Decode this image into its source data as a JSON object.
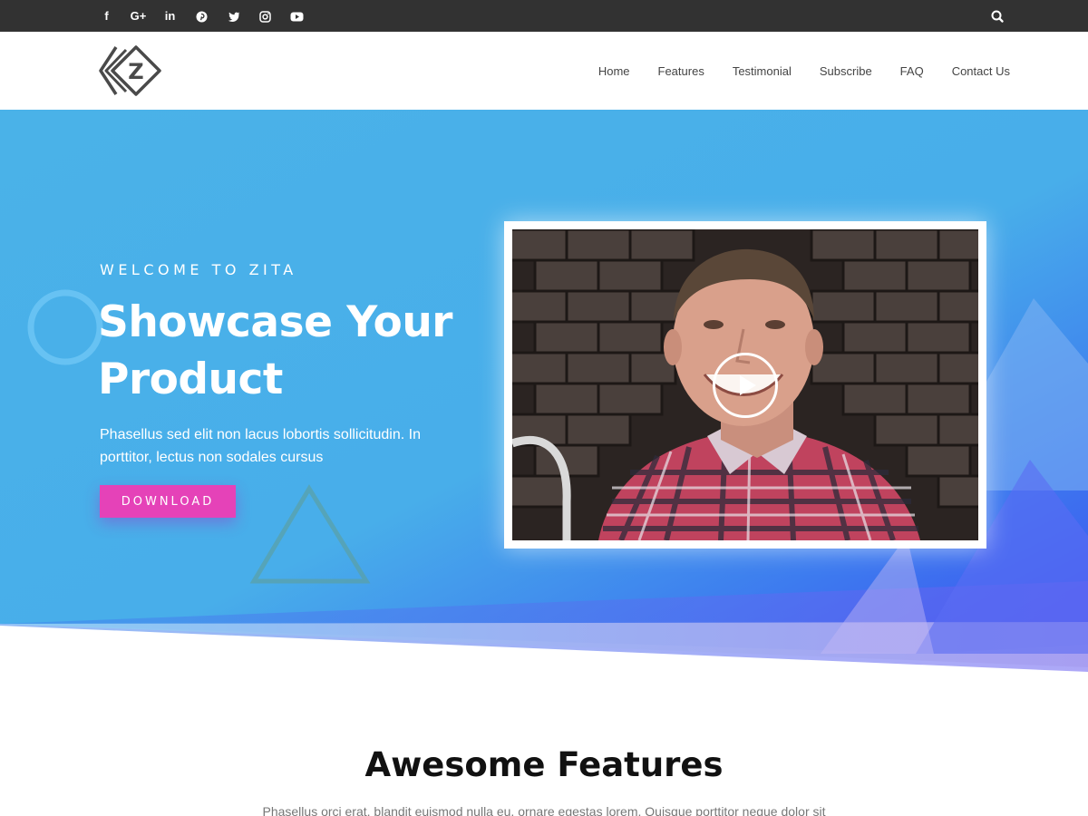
{
  "topbar": {
    "social": [
      {
        "icon": "facebook-icon",
        "glyph": "f"
      },
      {
        "icon": "google-plus-icon",
        "glyph": "G+"
      },
      {
        "icon": "linkedin-icon",
        "glyph": "in"
      },
      {
        "icon": "pinterest-icon",
        "glyph": ""
      },
      {
        "icon": "twitter-icon",
        "glyph": ""
      },
      {
        "icon": "instagram-icon",
        "glyph": ""
      },
      {
        "icon": "youtube-icon",
        "glyph": ""
      }
    ],
    "search_icon": "search-icon"
  },
  "header": {
    "logo_letter": "Z",
    "nav": [
      "Home",
      "Features",
      "Testimonial",
      "Subscribe",
      "FAQ",
      "Contact Us"
    ]
  },
  "hero": {
    "welcome": "WELCOME TO ZITA",
    "title": "Showcase Your Product",
    "description": "Phasellus sed elit non lacus lobortis sollicitudin. In porttitor, lectus non sodales cursus",
    "button_label": "DOWNLOAD",
    "play_icon": "play-icon"
  },
  "features": {
    "title": "Awesome Features",
    "description": "Phasellus orci erat, blandit euismod nulla eu, ornare egestas lorem. Quisque porttitor neque dolor sit"
  },
  "colors": {
    "topbar": "#323232",
    "hero_light": "#4ab0e8",
    "hero_deep": "#3d5cf0",
    "hero_violet": "#7e6bf0",
    "button": "#e542b8"
  }
}
